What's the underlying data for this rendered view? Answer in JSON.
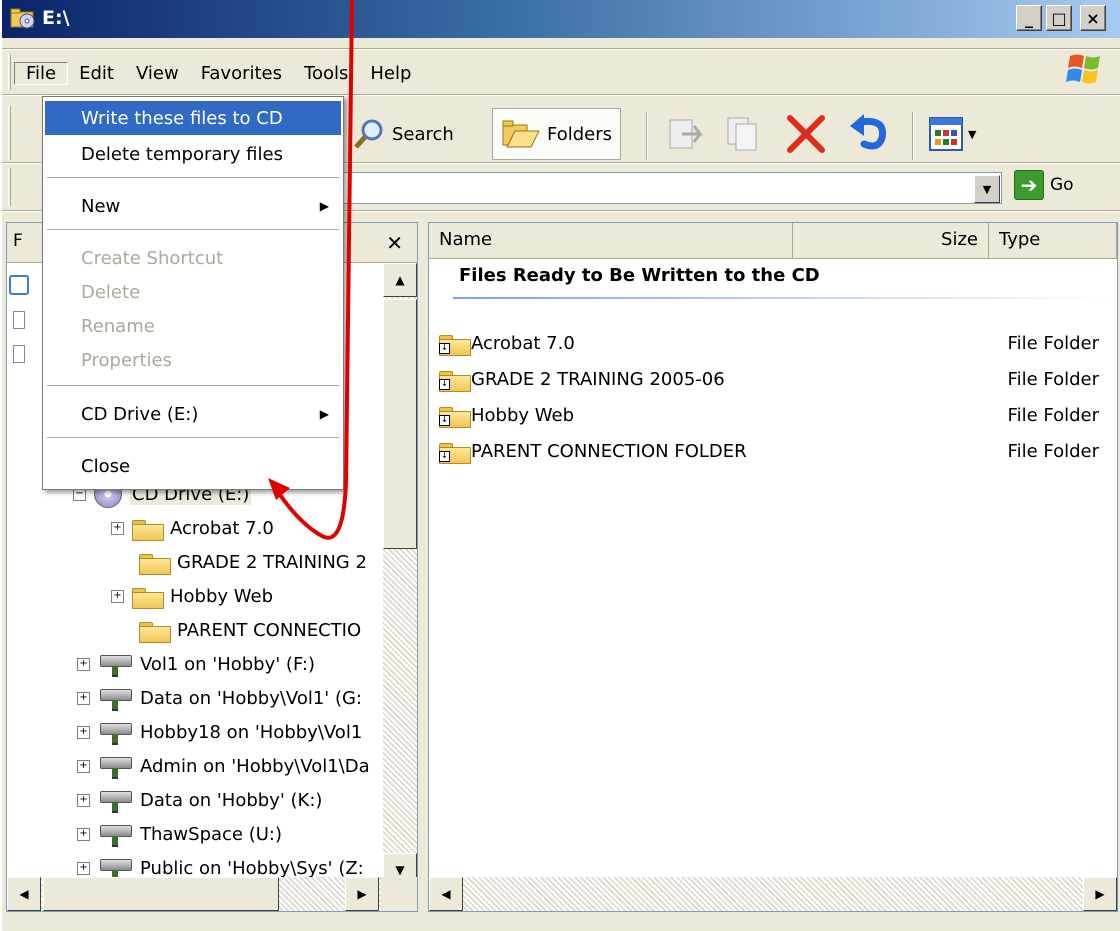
{
  "window": {
    "title": "E:\\",
    "controls": [
      "_",
      "□",
      "×"
    ]
  },
  "menubar": [
    "File",
    "Edit",
    "View",
    "Favorites",
    "Tools",
    "Help"
  ],
  "toolbar": {
    "search_label": "Search",
    "folders_label": "Folders"
  },
  "address": {
    "go_label": "Go"
  },
  "file_menu": {
    "items": [
      {
        "label": "Write these files to CD",
        "state": "highlighted"
      },
      {
        "label": "Delete temporary files",
        "state": "enabled"
      },
      {
        "label": "New",
        "state": "submenu"
      },
      {
        "label": "Create Shortcut",
        "state": "disabled"
      },
      {
        "label": "Delete",
        "state": "disabled"
      },
      {
        "label": "Rename",
        "state": "disabled"
      },
      {
        "label": "Properties",
        "state": "disabled"
      },
      {
        "label": "CD Drive (E:)",
        "state": "submenu"
      },
      {
        "label": "Close",
        "state": "enabled"
      }
    ]
  },
  "folders_pane": {
    "header_label": "F",
    "close_label": "✕",
    "tree": [
      {
        "label": "CD Drive (E:)",
        "expander": "−"
      },
      {
        "label": "Acrobat 7.0",
        "expander": "+"
      },
      {
        "label": "GRADE 2 TRAINING 2",
        "expander": ""
      },
      {
        "label": "Hobby Web",
        "expander": "+"
      },
      {
        "label": "PARENT CONNECTIO",
        "expander": ""
      },
      {
        "label": "Vol1 on 'Hobby' (F:)",
        "expander": "+"
      },
      {
        "label": "Data on 'Hobby\\Vol1' (G:",
        "expander": "+"
      },
      {
        "label": "Hobby18 on 'Hobby\\Vol1",
        "expander": "+"
      },
      {
        "label": "Admin on 'Hobby\\Vol1\\Da",
        "expander": "+"
      },
      {
        "label": "Data on 'Hobby' (K:)",
        "expander": "+"
      },
      {
        "label": "ThawSpace (U:)",
        "expander": "+"
      },
      {
        "label": "Public on 'Hobby\\Sys' (Z:",
        "expander": "+"
      }
    ]
  },
  "file_list": {
    "columns": [
      "Name",
      "Size",
      "Type"
    ],
    "group_header": "Files Ready to Be Written to the CD",
    "rows": [
      {
        "name": "Acrobat 7.0",
        "type": "File Folder"
      },
      {
        "name": "GRADE 2 TRAINING 2005-06",
        "type": "File Folder"
      },
      {
        "name": "Hobby Web",
        "type": "File Folder"
      },
      {
        "name": "PARENT CONNECTION FOLDER",
        "type": "File Folder"
      }
    ]
  },
  "annotation_color": "#e00000"
}
